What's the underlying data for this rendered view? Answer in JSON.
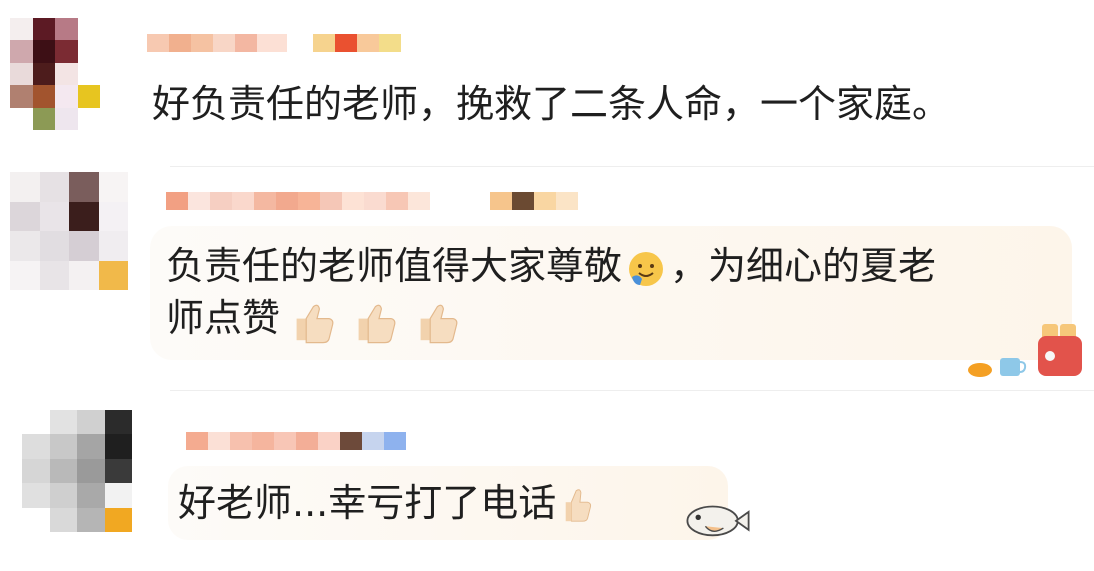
{
  "comments": [
    {
      "text": "好负责任的老师，挽救了二条人命，一个家庭。"
    },
    {
      "line1_a": "负责任的老师值得大家尊敬",
      "line1_b": "，为细心的夏老",
      "line2": "师点赞"
    },
    {
      "text": "好老师...幸亏打了电话"
    }
  ],
  "colors": {
    "text": "#1f1f1f",
    "bubble": "#fdf5ea",
    "thumb": "#f2d2ad",
    "divider": "#eeeeee"
  },
  "icons": [
    "smiling-face-icon",
    "thumbs-up-icon",
    "coffee-sticker-icon",
    "toaster-sticker-icon",
    "fish-sticker-icon"
  ]
}
